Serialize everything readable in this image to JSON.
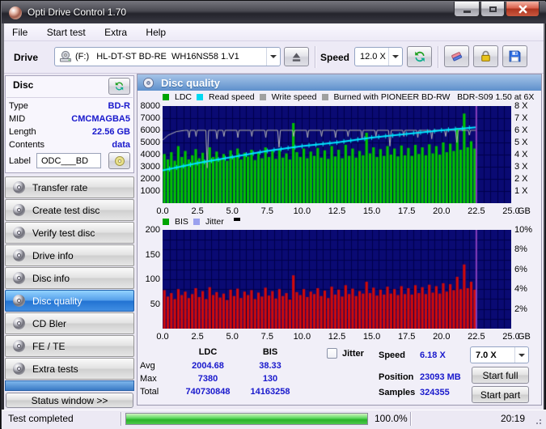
{
  "window": {
    "title": "Opti Drive Control 1.70"
  },
  "menu": {
    "items": [
      "File",
      "Start test",
      "Extra",
      "Help"
    ]
  },
  "toolbar": {
    "drive_label": "Drive",
    "drive_value": "(F:)   HL-DT-ST BD-RE  WH16NS58 1.V1",
    "speed_label": "Speed",
    "speed_value": "12.0 X"
  },
  "disc_panel": {
    "title": "Disc",
    "rows": [
      {
        "label": "Type",
        "value": "BD-R"
      },
      {
        "label": "MID",
        "value": "CMCMAGBA5"
      },
      {
        "label": "Length",
        "value": "22.56 GB"
      },
      {
        "label": "Contents",
        "value": "data"
      }
    ],
    "label_caption": "Label",
    "label_value": "ODC___BD"
  },
  "sidebar": {
    "items": [
      "Transfer rate",
      "Create test disc",
      "Verify test disc",
      "Drive info",
      "Disc info",
      "Disc quality",
      "CD Bler",
      "FE / TE",
      "Extra tests"
    ],
    "selected_index": 5,
    "status_window_label": "Status window >>"
  },
  "quality_panel": {
    "header": "Disc quality",
    "results": {
      "col_ldc": "LDC",
      "col_bis": "BIS",
      "rows": [
        {
          "name": "Avg",
          "ldc": "2004.68",
          "bis": "38.33"
        },
        {
          "name": "Max",
          "ldc": "7380",
          "bis": "130"
        },
        {
          "name": "Total",
          "ldc": "740730848",
          "bis": "14163258"
        }
      ]
    },
    "controls": {
      "jitter_label": "Jitter",
      "speed_label": "Speed",
      "speed_value": "6.18 X",
      "speed_select_value": "7.0 X",
      "position_label": "Position",
      "position_value": "23093 MB",
      "samples_label": "Samples",
      "samples_value": "324355",
      "start_full_label": "Start full",
      "start_part_label": "Start part"
    }
  },
  "statusbar": {
    "text": "Test completed",
    "percent": "100.0%",
    "time": "20:19"
  },
  "chart_data": [
    {
      "type": "bar",
      "title": "LDC errors with read and write speed overlay",
      "x_unit": "GB",
      "xlim": [
        0,
        25
      ],
      "x_tick_values": [
        0,
        2.5,
        5,
        7.5,
        10,
        12.5,
        15,
        17.5,
        20,
        22.5,
        25
      ],
      "x_tick_labels": [
        "0.0",
        "2.5",
        "5.0",
        "7.5",
        "10.0",
        "12.5",
        "15.0",
        "17.5",
        "20.0",
        "22.5",
        "25.0"
      ],
      "ylim_left": [
        0,
        8000
      ],
      "y_tick_values_left": [
        8000,
        7000,
        6000,
        5000,
        4000,
        3000,
        2000,
        1000
      ],
      "y_tick_labels_left": [
        "8000",
        "7000",
        "6000",
        "5000",
        "4000",
        "3000",
        "2000",
        "1000"
      ],
      "y_tick_values_right": [
        8000,
        7000,
        6000,
        5000,
        4000,
        3000,
        2000,
        1000
      ],
      "y_tick_labels_right": [
        "8 X",
        "7 X",
        "6 X",
        "5 X",
        "4 X",
        "3 X",
        "2 X",
        "1 X"
      ],
      "legend": [
        {
          "label": "LDC",
          "color": "#00a400"
        },
        {
          "label": "Read speed",
          "color": "#00d8f0"
        },
        {
          "label": "Write speed",
          "color": "#a0a0a0"
        },
        {
          "label": "Burned with PIONEER BD-RW   BDR-S09 1.50 at 6X",
          "color": "#a0a0a0"
        }
      ],
      "bg": "#0a0a73",
      "grid": "#00004a",
      "grid_hstep": 1000,
      "bar_color": "#00c400",
      "bar_step_gb": 0.25,
      "bars": [
        4050,
        3600,
        4200,
        3500,
        4700,
        3800,
        4300,
        3600,
        3950,
        4450,
        3700,
        4150,
        3550,
        4600,
        3800,
        4250,
        3650,
        4050,
        3500,
        4350,
        3750,
        4500,
        3600,
        4150,
        3850,
        4400,
        3550,
        4200,
        3700,
        4600,
        3800,
        4300,
        3650,
        4450,
        3750,
        4100,
        3600,
        6600,
        4200,
        3800,
        4500,
        3700,
        4250,
        3900,
        4550,
        3750,
        4350,
        3650,
        4700,
        3850,
        4400,
        3700,
        4800,
        3900,
        4500,
        3750,
        4300,
        3950,
        5800,
        4100,
        4600,
        3800,
        4450,
        3900,
        4700,
        4000,
        4500,
        3850,
        4750,
        3950,
        4550,
        3900,
        4800,
        4050,
        4600,
        3950,
        4850,
        4100,
        4700,
        4000,
        5000,
        4200,
        4900,
        4300,
        6200,
        4400,
        7380,
        4600,
        5100,
        4500
      ],
      "read_speed_x_units": {
        "color": "#00e6ff",
        "x": [
          0,
          2.5,
          5,
          7.5,
          10,
          12.5,
          15,
          17.5,
          20,
          22.5
        ],
        "y": [
          2.7,
          3.3,
          3.8,
          4.3,
          4.7,
          5.0,
          5.4,
          5.7,
          6.0,
          6.25
        ]
      },
      "write_speed_x_units": {
        "color": "#b4b4b4",
        "x": [
          0,
          0.4,
          1.0,
          1.6,
          1.82,
          1.9,
          1.98,
          2.32,
          2.4,
          2.48,
          3.1,
          3.2,
          3.3,
          3.82,
          3.9,
          3.98,
          4.32,
          4.4,
          4.48,
          5.32,
          5.4,
          5.48,
          6.32,
          6.4,
          6.48,
          7.32,
          7.4,
          7.48,
          8.25,
          8.35,
          8.45,
          9.32,
          9.4,
          9.48,
          10.32,
          10.4,
          10.48,
          11.32,
          11.4,
          11.48,
          12.32,
          12.4,
          12.48,
          13.22,
          13.3,
          13.38,
          14.22,
          14.3,
          14.38,
          15.22,
          15.3,
          15.38,
          16.2,
          16.3,
          16.4,
          17.22,
          17.3,
          17.38,
          18.22,
          18.3,
          18.38,
          19.22,
          19.3,
          19.38,
          20.22,
          20.3,
          20.38,
          21.0,
          21.1,
          21.2,
          21.92,
          22.0,
          22.08,
          22.5
        ],
        "y": [
          5.2,
          5.6,
          5.9,
          6.0,
          6.0,
          5.4,
          6.0,
          6.0,
          5.5,
          6.0,
          6.0,
          2.9,
          6.0,
          6.0,
          5.3,
          6.0,
          6.0,
          5.5,
          6.0,
          6.0,
          5.4,
          6.0,
          6.0,
          5.5,
          6.0,
          6.0,
          5.4,
          6.0,
          6.0,
          4.6,
          6.0,
          6.0,
          5.5,
          6.0,
          6.0,
          5.4,
          6.0,
          6.0,
          5.5,
          6.0,
          6.0,
          5.4,
          6.0,
          6.0,
          5.5,
          6.0,
          6.0,
          5.3,
          6.0,
          6.0,
          5.5,
          6.0,
          6.0,
          4.7,
          6.0,
          6.0,
          5.5,
          6.0,
          6.0,
          5.4,
          6.0,
          6.0,
          5.3,
          6.0,
          6.0,
          5.5,
          6.0,
          6.0,
          5.0,
          6.0,
          6.0,
          5.6,
          6.0,
          6.0
        ]
      },
      "end_marker_gb": 22.5,
      "end_marker_color": "#8a3fc0"
    },
    {
      "type": "bar",
      "title": "BIS errors",
      "x_unit": "GB",
      "xlim": [
        0,
        25
      ],
      "x_tick_values": [
        0,
        2.5,
        5,
        7.5,
        10,
        12.5,
        15,
        17.5,
        20,
        22.5,
        25
      ],
      "x_tick_labels": [
        "0.0",
        "2.5",
        "5.0",
        "7.5",
        "10.0",
        "12.5",
        "15.0",
        "17.5",
        "20.0",
        "22.5",
        "25.0"
      ],
      "ylim_left": [
        0,
        200
      ],
      "y_tick_values_left": [
        200,
        150,
        100,
        50
      ],
      "y_tick_labels_left": [
        "200",
        "150",
        "100",
        "50"
      ],
      "y_tick_values_right": [
        200,
        160,
        120,
        80,
        40
      ],
      "y_tick_labels_right": [
        "10%",
        "8%",
        "6%",
        "4%",
        "2%"
      ],
      "legend": [
        {
          "label": "BIS",
          "color": "#00a400"
        },
        {
          "label": "Jitter",
          "color": "#9aa0ee"
        }
      ],
      "extra_mark_color": "#000000",
      "bg": "#0a0a73",
      "grid": "#00004a",
      "grid_hstep": 20,
      "bar_color": "#d20a0a",
      "bar_step_gb": 0.25,
      "bars": [
        78,
        65,
        72,
        60,
        80,
        68,
        75,
        62,
        70,
        82,
        64,
        76,
        60,
        84,
        68,
        74,
        63,
        71,
        58,
        79,
        66,
        81,
        62,
        75,
        68,
        78,
        60,
        73,
        65,
        83,
        67,
        76,
        61,
        80,
        66,
        72,
        59,
        108,
        74,
        68,
        80,
        64,
        75,
        70,
        82,
        66,
        77,
        62,
        85,
        69,
        79,
        65,
        88,
        70,
        81,
        66,
        76,
        71,
        95,
        72,
        83,
        67,
        79,
        69,
        85,
        71,
        80,
        68,
        86,
        70,
        82,
        69,
        88,
        72,
        84,
        70,
        89,
        73,
        86,
        71,
        92,
        75,
        90,
        78,
        105,
        80,
        130,
        82,
        95,
        79
      ],
      "end_marker_gb": 22.5,
      "end_marker_color": "#8a3fc0"
    }
  ]
}
